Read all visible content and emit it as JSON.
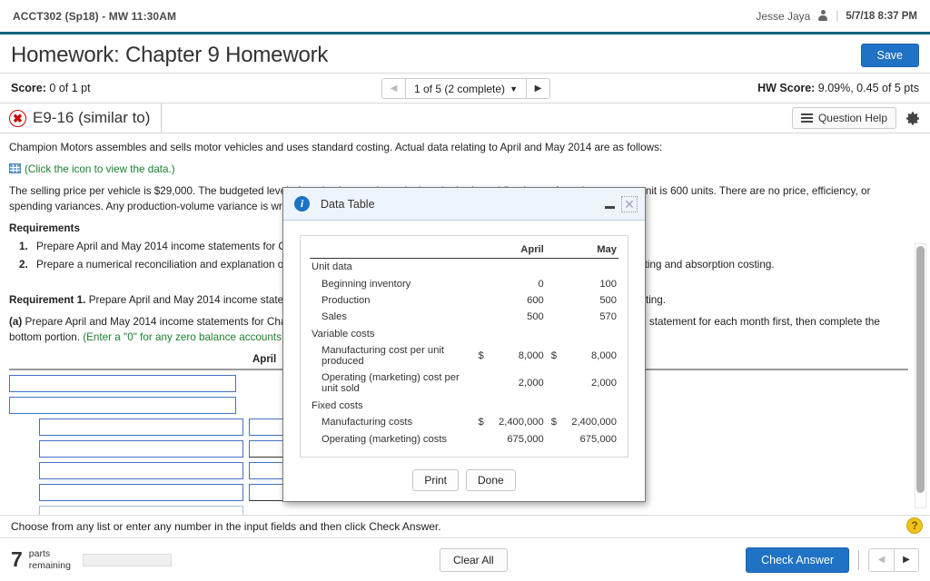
{
  "coursebar": {
    "course": "ACCT302 (Sp18) - MW 11:30AM",
    "user": "Jesse Jaya",
    "person_icon": "person-icon",
    "separator": "|",
    "timestamp": "5/7/18 8:37 PM"
  },
  "titlebar": {
    "title": "Homework: Chapter 9 Homework",
    "save_label": "Save"
  },
  "scorebar": {
    "score_label": "Score:",
    "score_value": "0 of 1 pt",
    "nav": {
      "prev_icon": "triangle-left-icon",
      "next_icon": "triangle-right-icon",
      "label": "1 of 5 (2 complete)",
      "caret_icon": "caret-down-icon"
    },
    "hw_score_label": "HW Score:",
    "hw_score_value": "9.09%, 0.45 of 5 pts"
  },
  "question_header": {
    "status_icon": "x-circle-icon",
    "status_glyph": "✖",
    "question_id": "E9-16 (similar to)",
    "help_label": "Question Help",
    "help_icon": "list-icon",
    "gear_icon": "gear-icon"
  },
  "question_body": {
    "intro": "Champion Motors assembles and sells motor vehicles and uses standard costing. Actual data relating to April and May 2014 are as follows:",
    "data_link_icon": "grid-table-icon",
    "data_link_text": "(Click the icon to view the data.)",
    "paragraph2": "The selling price per vehicle is $29,000. The budgeted level of production used to calculate the budgeted fixed manufacturing cost per unit is 600 units. There are no price, efficiency, or spending variances. Any production-volume variance is written off to cost of goods sold in the month in which it occurs.",
    "requirements_title": "Requirements",
    "requirements": [
      "Prepare April and May 2014 income statements for Champion Motors under (a) variable costing and (b) absorption costing.",
      "Prepare a numerical reconciliation and explanation of the difference between operating income for each month under variable costing and absorption costing."
    ],
    "req1_bold": "Requirement 1.",
    "req1_text": "Prepare April and May 2014 income statements for Champion Motors under (a) variable costing and (b) absorption costing.",
    "parta_bold": "(a)",
    "parta_text": "Prepare April and May 2014 income statements for Champion Motors under variable costing. Complete the top portion of the income statement for each month first, then complete the bottom portion.",
    "parta_green": "(Enter a \"0\" for any zero balance accounts.)",
    "column_header_april": "April"
  },
  "dialog": {
    "icon": "info-icon",
    "title": "Data Table",
    "minimize_icon": "minimize-icon",
    "close_icon": "close-icon",
    "print_label": "Print",
    "done_label": "Done",
    "table": {
      "columns": [
        "",
        "April",
        "May"
      ],
      "rows": [
        {
          "label": "Unit data",
          "type": "section",
          "april": "",
          "may": "",
          "april_cur": "",
          "may_cur": ""
        },
        {
          "label": "Beginning inventory",
          "type": "item",
          "april": "0",
          "may": "100",
          "april_cur": "",
          "may_cur": ""
        },
        {
          "label": "Production",
          "type": "item",
          "april": "600",
          "may": "500",
          "april_cur": "",
          "may_cur": ""
        },
        {
          "label": "Sales",
          "type": "item",
          "april": "500",
          "may": "570",
          "april_cur": "",
          "may_cur": ""
        },
        {
          "label": "Variable costs",
          "type": "section",
          "april": "",
          "may": "",
          "april_cur": "",
          "may_cur": ""
        },
        {
          "label": "Manufacturing cost per unit produced",
          "type": "item",
          "april": "8,000",
          "may": "8,000",
          "april_cur": "$",
          "may_cur": "$"
        },
        {
          "label": "Operating (marketing) cost per unit sold",
          "type": "item",
          "april": "2,000",
          "may": "2,000",
          "april_cur": "",
          "may_cur": ""
        },
        {
          "label": "Fixed costs",
          "type": "section",
          "april": "",
          "may": "",
          "april_cur": "",
          "may_cur": ""
        },
        {
          "label": "Manufacturing costs",
          "type": "item",
          "april": "2,400,000",
          "may": "2,400,000",
          "april_cur": "$",
          "may_cur": "$"
        },
        {
          "label": "Operating (marketing) costs",
          "type": "item",
          "april": "675,000",
          "may": "675,000",
          "april_cur": "",
          "may_cur": ""
        }
      ]
    }
  },
  "hintbar": {
    "text": "Choose from any list or enter any number in the input fields and then click Check Answer.",
    "help_glyph": "?"
  },
  "bottombar": {
    "parts_remaining_count": "7",
    "parts_remaining_label_line1": "parts",
    "parts_remaining_label_line2": "remaining",
    "progress_percent": 22,
    "clear_all_label": "Clear All",
    "check_answer_label": "Check Answer",
    "prev_icon": "triangle-left-icon",
    "next_icon": "triangle-right-icon"
  },
  "colors": {
    "accent_blue": "#1f72c4",
    "header_rule": "#11657f",
    "green_text": "#1d7f2e",
    "error_red": "#cc0000",
    "input_border": "#4472c4"
  }
}
